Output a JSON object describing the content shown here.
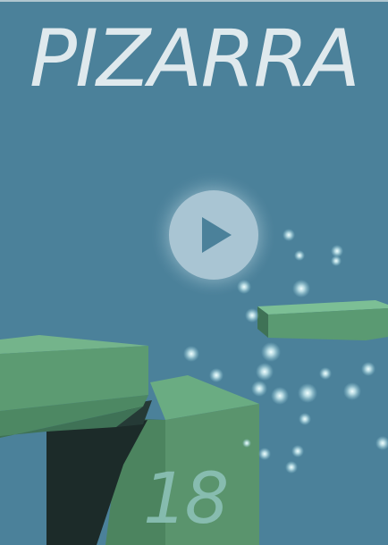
{
  "game": {
    "title": "PIZARRA",
    "score": "18",
    "play_icon": "play-icon"
  },
  "colors": {
    "background": "#4b819a",
    "title": "#dfe9ed",
    "play_button": "#a9c5d3",
    "platform_top": "#6fb389",
    "platform_front": "#4f8a66",
    "platform_side": "#3f7256",
    "shadow": "#1c2b29",
    "score": "#8cc1b7",
    "particle": "#d8f2f5"
  }
}
